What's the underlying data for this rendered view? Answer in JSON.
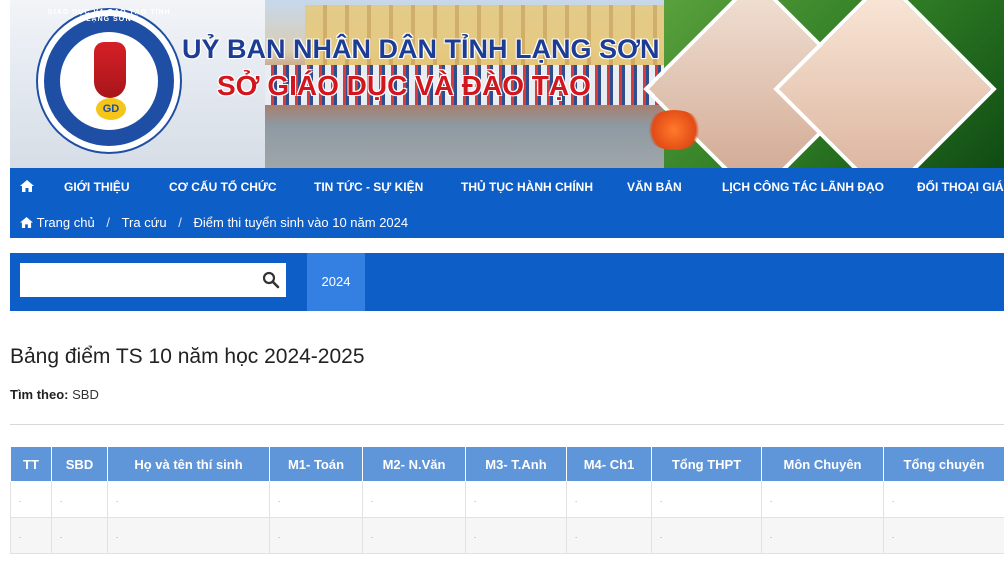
{
  "banner": {
    "title_line1": "UỶ BAN NHÂN DÂN TỈNH LẠNG SƠN",
    "title_line2": "SỞ GIÁO DỤC VÀ ĐÀO TẠO",
    "logo_ring_text": "GIÁO DỤC VÀ ĐÀO TẠO TỈNH LẠNG SƠN",
    "logo_mark": "GD"
  },
  "nav": {
    "home_icon": "home-icon",
    "items": [
      "GIỚI THIỆU",
      "CƠ CẤU TỔ CHỨC",
      "TIN TỨC - SỰ KIỆN",
      "THỦ TỤC HÀNH CHÍNH",
      "VĂN BẢN",
      "LỊCH CÔNG TÁC LÃNH ĐẠO",
      "ĐỐI THOẠI GIÁO"
    ]
  },
  "breadcrumb": {
    "home": "Trang chủ",
    "lookup": "Tra cứu",
    "current": "Điểm thi tuyển sinh vào 10 năm 2024",
    "separator": "/"
  },
  "search": {
    "value": "",
    "placeholder": "",
    "button_icon": "search-icon"
  },
  "year_tab": "2024",
  "page_title": "Bảng điểm TS 10 năm học 2024-2025",
  "filter": {
    "label": "Tìm theo:",
    "value": "SBD"
  },
  "table": {
    "headers": [
      "TT",
      "SBD",
      "Họ và tên thí sinh",
      "M1- Toán",
      "M2- N.Văn",
      "M3- T.Anh",
      "M4- Ch1",
      "Tổng THPT",
      "Môn Chuyên",
      "Tổng chuyên"
    ],
    "rows": [
      [
        ".",
        ".",
        ".",
        ".",
        ".",
        ".",
        ".",
        ".",
        ".",
        "."
      ],
      [
        ".",
        ".",
        ".",
        ".",
        ".",
        ".",
        ".",
        ".",
        ".",
        "."
      ]
    ]
  },
  "colors": {
    "nav_blue": "#0e5ec7",
    "tab_active": "#3480e2",
    "table_header": "#5f95d9",
    "title_blue": "#1c3d93",
    "title_red": "#d2161e"
  }
}
